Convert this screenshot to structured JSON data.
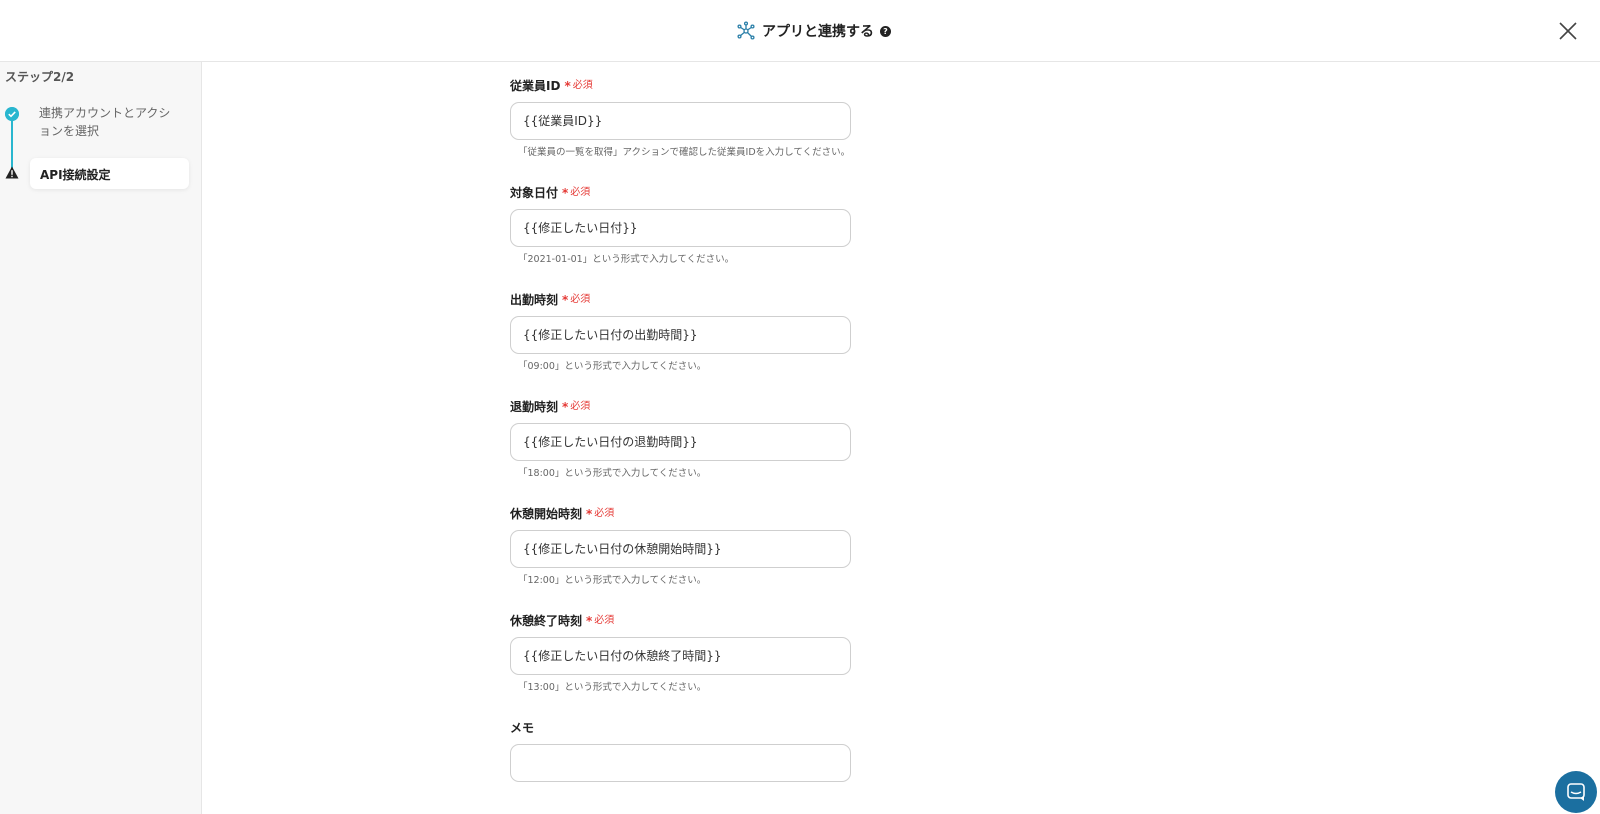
{
  "header": {
    "title": "アプリと連携する",
    "help_icon": "?",
    "app_icon": "network-icon",
    "close_icon": "close-icon"
  },
  "sidebar": {
    "step_label": "ステップ2/2",
    "steps": [
      {
        "label": "連携アカウントとアクションを選択",
        "status": "done"
      },
      {
        "label": "API接続設定",
        "status": "warning"
      }
    ]
  },
  "form": {
    "required_star": "*",
    "required_text": "必須",
    "fields": [
      {
        "label": "従業員ID",
        "required": true,
        "value": "{{従業員ID}}",
        "hint": "「従業員の一覧を取得」アクションで確認した従業員IDを入力してください。"
      },
      {
        "label": "対象日付",
        "required": true,
        "value": "{{修正したい日付}}",
        "hint": "「2021-01-01」という形式で入力してください。"
      },
      {
        "label": "出勤時刻",
        "required": true,
        "value": "{{修正したい日付の出勤時間}}",
        "hint": "「09:00」という形式で入力してください。"
      },
      {
        "label": "退勤時刻",
        "required": true,
        "value": "{{修正したい日付の退勤時間}}",
        "hint": "「18:00」という形式で入力してください。"
      },
      {
        "label": "休憩開始時刻",
        "required": true,
        "value": "{{修正したい日付の休憩開始時間}}",
        "hint": "「12:00」という形式で入力してください。"
      },
      {
        "label": "休憩終了時刻",
        "required": true,
        "value": "{{修正したい日付の休憩終了時間}}",
        "hint": "「13:00」という形式で入力してください。"
      },
      {
        "label": "メモ",
        "required": false,
        "value": "",
        "hint": ""
      }
    ]
  },
  "colors": {
    "accent": "#29b6cf",
    "required": "#e53935",
    "chat": "#1b6fa0"
  }
}
